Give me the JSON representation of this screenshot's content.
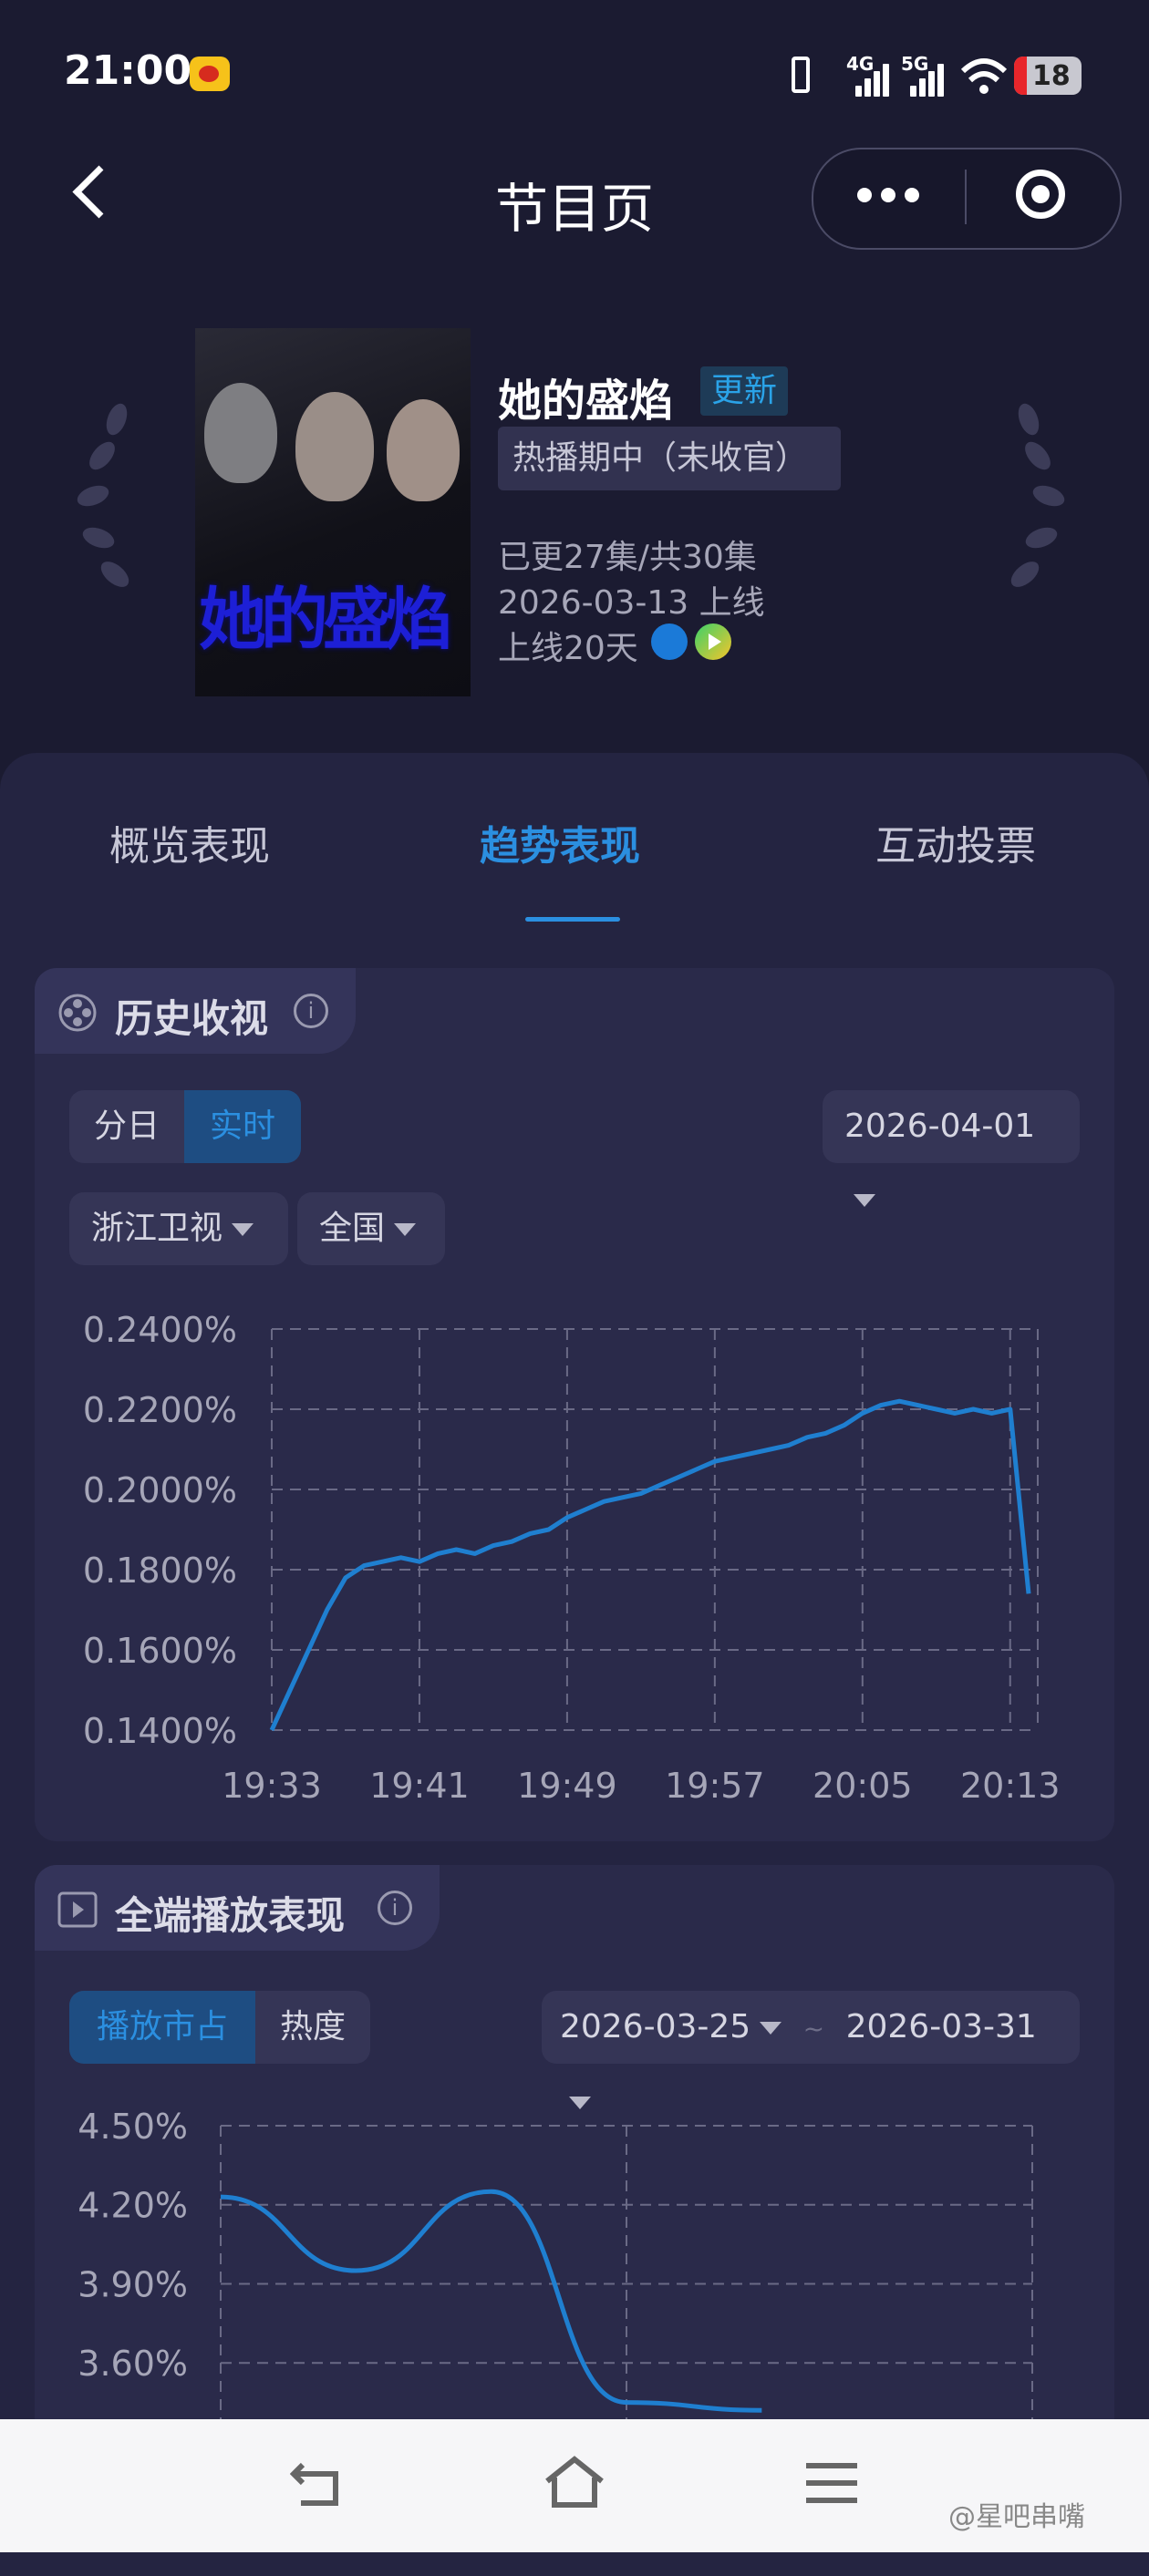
{
  "status_bar": {
    "time": "21:00",
    "signal1": "4G",
    "signal2": "5G",
    "battery": "18"
  },
  "nav": {
    "title": "节目页"
  },
  "show": {
    "name": "她的盛焰",
    "update_badge": "更新",
    "status": "热播期中（未收官）",
    "episodes": "已更27集/共30集",
    "premiere": "2026-03-13 上线",
    "days_online": "上线20天",
    "poster_title": "她的盛焰"
  },
  "tabs": [
    {
      "label": "概览表现",
      "active": false
    },
    {
      "label": "趋势表现",
      "active": true
    },
    {
      "label": "互动投票",
      "active": false
    }
  ],
  "ratings_card": {
    "title": "历史收视",
    "mode_tabs": [
      "分日",
      "实时"
    ],
    "active_mode": "实时",
    "date": "2026-04-01",
    "channel": "浙江卫视",
    "region": "全国"
  },
  "play_card": {
    "title": "全端播放表现",
    "mode_tabs": [
      "播放市占",
      "热度"
    ],
    "active_mode": "播放市占",
    "date_start": "2026-03-25",
    "date_sep": "~",
    "date_end": "2026-03-31"
  },
  "chart_data": [
    {
      "type": "line",
      "y_ticks": [
        "0.2400%",
        "0.2200%",
        "0.2000%",
        "0.1800%",
        "0.1600%",
        "0.1400%"
      ],
      "x_ticks": [
        "19:33",
        "19:41",
        "19:49",
        "19:57",
        "20:05",
        "20:13"
      ],
      "ylim": [
        0.14,
        0.24
      ],
      "grid": true,
      "series": [
        {
          "color": "#1f7fd0",
          "x": [
            "19:33",
            "19:34",
            "19:35",
            "19:36",
            "19:37",
            "19:38",
            "19:39",
            "19:40",
            "19:41",
            "19:42",
            "19:43",
            "19:44",
            "19:45",
            "19:46",
            "19:47",
            "19:48",
            "19:49",
            "19:50",
            "19:51",
            "19:52",
            "19:53",
            "19:54",
            "19:55",
            "19:56",
            "19:57",
            "19:58",
            "19:59",
            "20:00",
            "20:01",
            "20:02",
            "20:03",
            "20:04",
            "20:05",
            "20:06",
            "20:07",
            "20:08",
            "20:09",
            "20:10",
            "20:11",
            "20:12",
            "20:13",
            "20:14"
          ],
          "values": [
            0.14,
            0.15,
            0.16,
            0.17,
            0.178,
            0.181,
            0.182,
            0.183,
            0.182,
            0.184,
            0.185,
            0.184,
            0.186,
            0.187,
            0.189,
            0.19,
            0.193,
            0.195,
            0.197,
            0.198,
            0.199,
            0.201,
            0.203,
            0.205,
            0.207,
            0.208,
            0.209,
            0.21,
            0.211,
            0.213,
            0.214,
            0.216,
            0.219,
            0.221,
            0.222,
            0.221,
            0.22,
            0.219,
            0.22,
            0.219,
            0.22,
            0.174
          ]
        }
      ]
    },
    {
      "type": "line",
      "y_ticks": [
        "4.50%",
        "4.20%",
        "3.90%",
        "3.60%"
      ],
      "ylim": [
        3.3,
        4.5
      ],
      "grid": true,
      "series": [
        {
          "color": "#1f7fd0",
          "x": [
            "2026-03-25",
            "2026-03-26",
            "2026-03-27",
            "2026-03-28",
            "2026-03-29"
          ],
          "values": [
            4.23,
            3.95,
            4.25,
            3.45,
            3.42
          ]
        }
      ]
    }
  ],
  "watermark": "@星吧串嘴"
}
